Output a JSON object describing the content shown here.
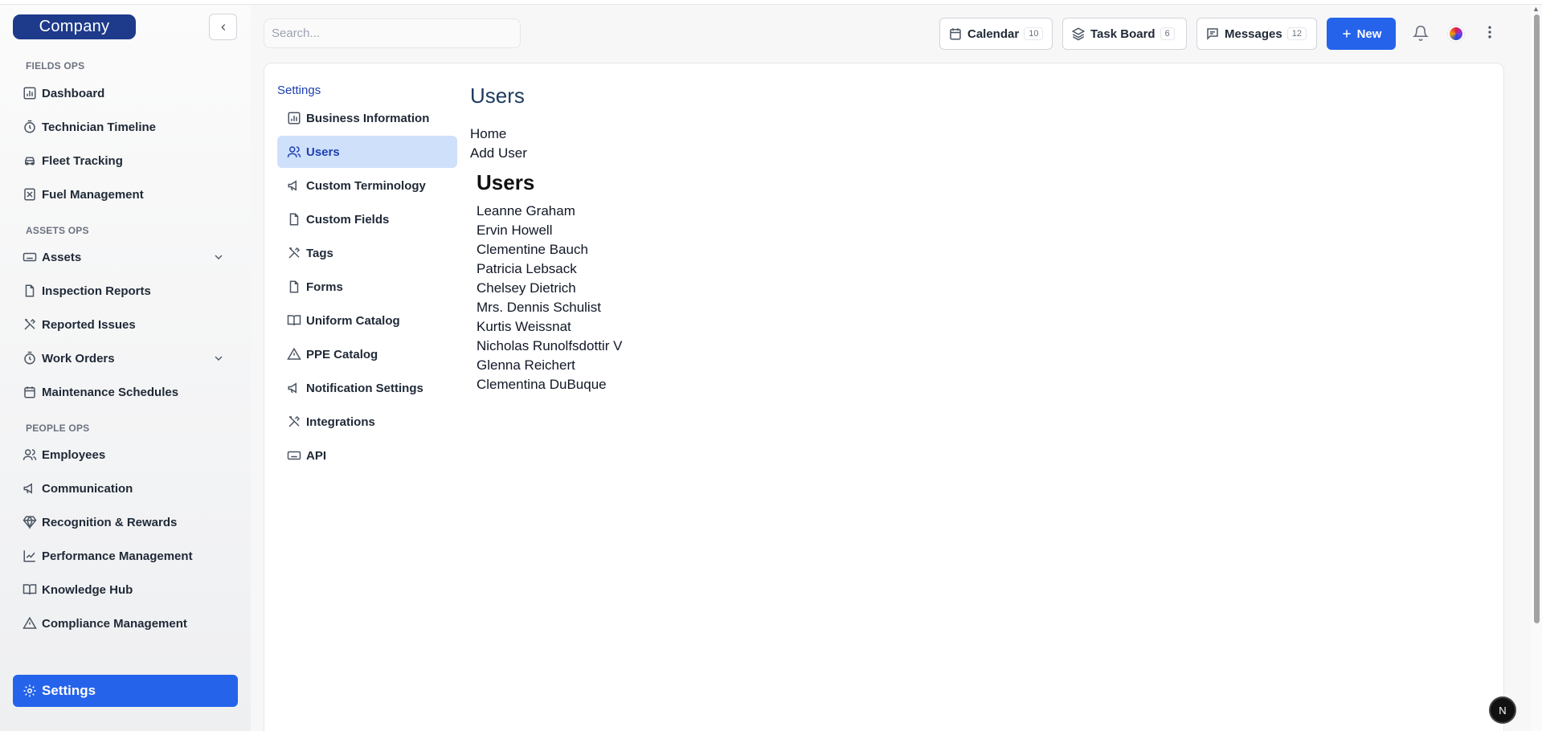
{
  "brand": {
    "logo_text": "Company"
  },
  "sidebar": {
    "sections": [
      {
        "label": "FIELDS OPS"
      },
      {
        "label": "ASSETS OPS"
      },
      {
        "label": "PEOPLE OPS"
      }
    ],
    "items": [
      {
        "label": "Dashboard",
        "icon": "chart-icon"
      },
      {
        "label": "Technician Timeline",
        "icon": "clock-icon"
      },
      {
        "label": "Fleet Tracking",
        "icon": "car-icon"
      },
      {
        "label": "Fuel Management",
        "icon": "fuel-icon"
      },
      {
        "label": "Assets",
        "icon": "keyboard-icon"
      },
      {
        "label": "Inspection Reports",
        "icon": "file-icon"
      },
      {
        "label": "Reported Issues",
        "icon": "tools-icon"
      },
      {
        "label": "Work Orders",
        "icon": "clock-icon"
      },
      {
        "label": "Maintenance Schedules",
        "icon": "calendar-icon"
      },
      {
        "label": "Employees",
        "icon": "users-icon"
      },
      {
        "label": "Communication",
        "icon": "megaphone-icon"
      },
      {
        "label": "Recognition & Rewards",
        "icon": "gem-icon"
      },
      {
        "label": "Performance Management",
        "icon": "trending-icon"
      },
      {
        "label": "Knowledge Hub",
        "icon": "book-icon"
      },
      {
        "label": "Compliance Management",
        "icon": "warning-icon"
      }
    ],
    "settings_label": "Settings"
  },
  "topbar": {
    "search_placeholder": "Search...",
    "calendar": {
      "label": "Calendar",
      "count": "10"
    },
    "taskboard": {
      "label": "Task Board",
      "count": "6"
    },
    "messages": {
      "label": "Messages",
      "count": "12"
    },
    "new_label": "New"
  },
  "settings_nav": {
    "title": "Settings",
    "items": [
      {
        "label": "Business Information",
        "icon": "chart-icon"
      },
      {
        "label": "Users",
        "icon": "users-icon",
        "active": true
      },
      {
        "label": "Custom Terminology",
        "icon": "megaphone-icon"
      },
      {
        "label": "Custom Fields",
        "icon": "file-icon"
      },
      {
        "label": "Tags",
        "icon": "tools-icon"
      },
      {
        "label": "Forms",
        "icon": "file-icon"
      },
      {
        "label": "Uniform Catalog",
        "icon": "book-icon"
      },
      {
        "label": "PPE Catalog",
        "icon": "warning-icon"
      },
      {
        "label": "Notification Settings",
        "icon": "megaphone-icon"
      },
      {
        "label": "Integrations",
        "icon": "tools-icon"
      },
      {
        "label": "API",
        "icon": "keyboard-icon"
      }
    ]
  },
  "content": {
    "page_title": "Users",
    "links": [
      "Home",
      "Add User"
    ],
    "list_title": "Users",
    "users": [
      "Leanne Graham",
      "Ervin Howell",
      "Clementine Bauch",
      "Patricia Lebsack",
      "Chelsey Dietrich",
      "Mrs. Dennis Schulist",
      "Kurtis Weissnat",
      "Nicholas Runolfsdottir V",
      "Glenna Reichert",
      "Clementina DuBuque"
    ]
  },
  "dev_badge": "N",
  "colors": {
    "accent": "#2563eb",
    "brand": "#1e3a8a",
    "active_bg": "#cfe0fb"
  }
}
